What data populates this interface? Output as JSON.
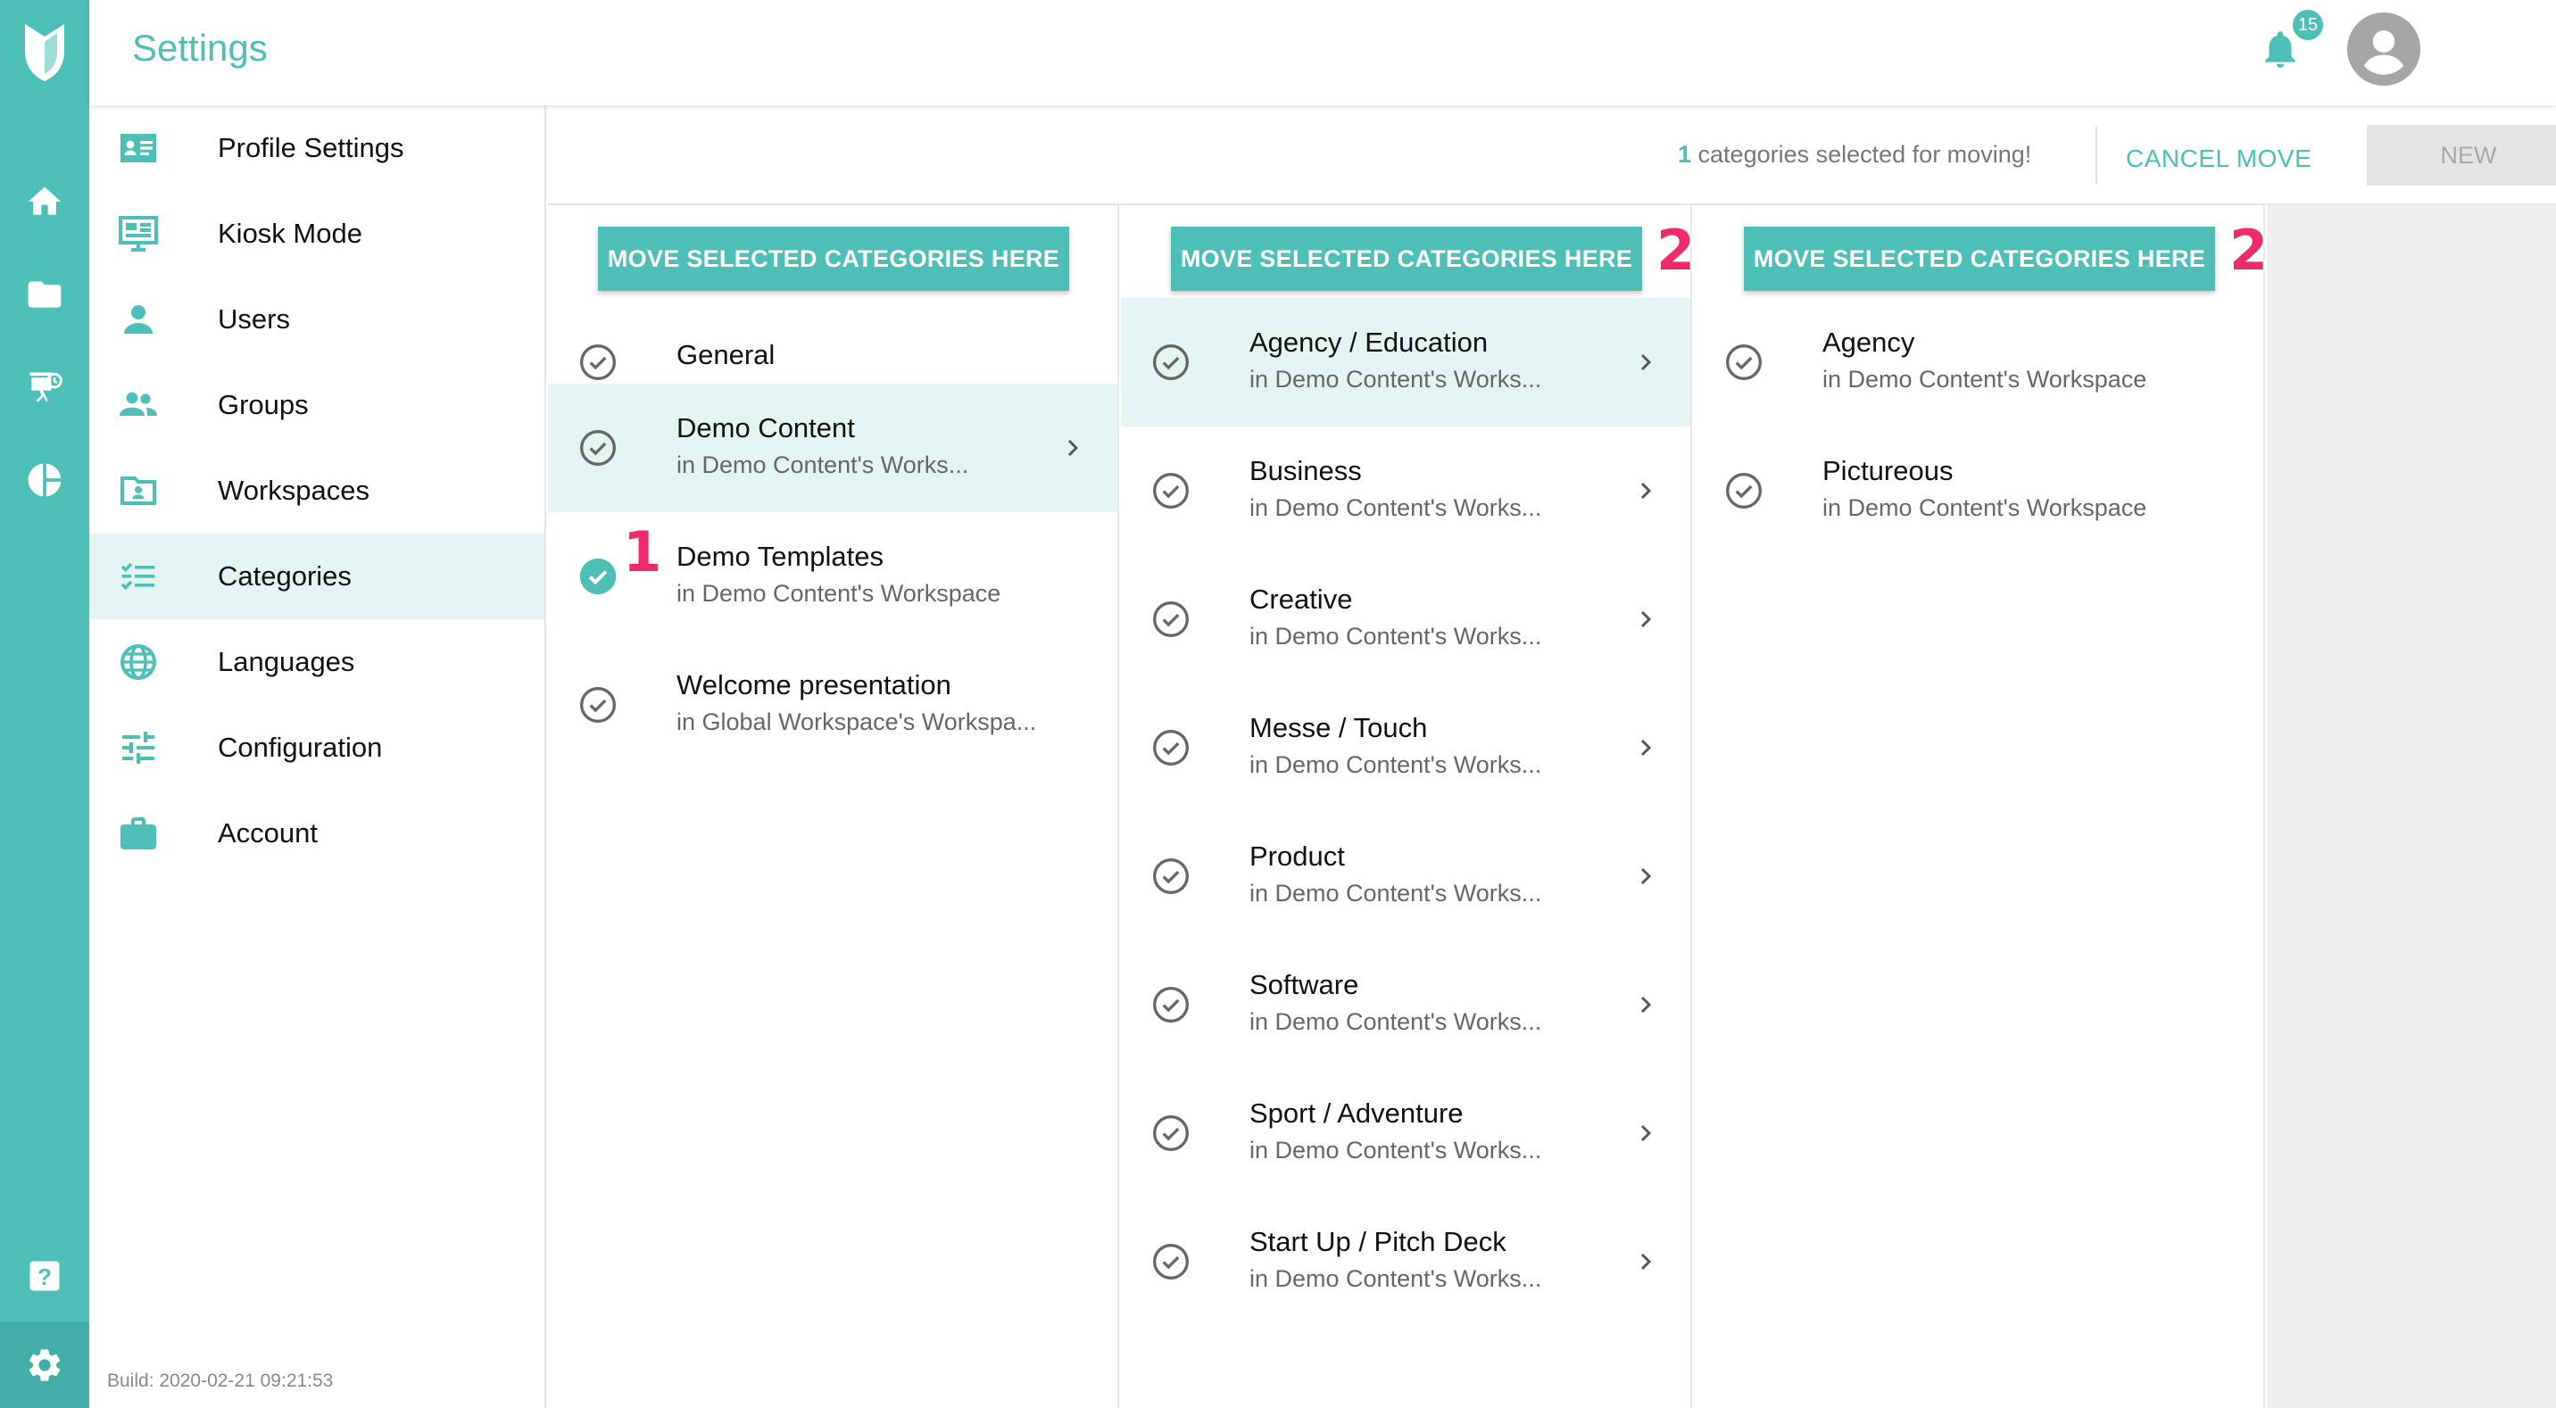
{
  "app": {
    "title": "Settings",
    "notifications": {
      "count": "15"
    },
    "build": "Build: 2020-02-21 09:21:53"
  },
  "rail": {
    "items": [
      {
        "name": "home-icon"
      },
      {
        "name": "folder-icon"
      },
      {
        "name": "presentation-icon"
      },
      {
        "name": "pie-chart-icon"
      },
      {
        "name": "help-icon"
      },
      {
        "name": "gear-icon"
      }
    ]
  },
  "settings_nav": {
    "items": [
      {
        "label": "Profile Settings",
        "icon": "profile-card-icon"
      },
      {
        "label": "Kiosk Mode",
        "icon": "monitor-icon"
      },
      {
        "label": "Users",
        "icon": "user-icon"
      },
      {
        "label": "Groups",
        "icon": "group-icon"
      },
      {
        "label": "Workspaces",
        "icon": "workspace-icon"
      },
      {
        "label": "Categories",
        "icon": "categories-icon",
        "active": true
      },
      {
        "label": "Languages",
        "icon": "globe-icon"
      },
      {
        "label": "Configuration",
        "icon": "sliders-icon"
      },
      {
        "label": "Account",
        "icon": "briefcase-icon"
      }
    ]
  },
  "toolbar": {
    "selected_count": "1",
    "selected_text": " categories selected for moving!",
    "cancel_label": "CANCEL MOVE",
    "new_label": "NEW"
  },
  "columns": [
    {
      "move_label": "MOVE SELECTED CATEGORIES HERE",
      "items": [
        {
          "name": "General",
          "sub": "",
          "selected": false,
          "chevron": false
        },
        {
          "name": "Demo Content",
          "sub": "in Demo Content's Works...",
          "selected": false,
          "chevron": true,
          "active": true
        },
        {
          "name": "Demo Templates",
          "sub": "in Demo Content's Workspace",
          "selected": true,
          "chevron": false,
          "marker": "1"
        },
        {
          "name": "Welcome presentation",
          "sub": "in Global Workspace's Workspa...",
          "selected": false,
          "chevron": false
        }
      ]
    },
    {
      "move_label": "MOVE SELECTED CATEGORIES HERE",
      "marker": "2",
      "items": [
        {
          "name": "Agency / Education",
          "sub": "in Demo Content's Works...",
          "chevron": true,
          "active": true
        },
        {
          "name": "Business",
          "sub": "in Demo Content's Works...",
          "chevron": true
        },
        {
          "name": "Creative",
          "sub": "in Demo Content's Works...",
          "chevron": true
        },
        {
          "name": "Messe / Touch",
          "sub": "in Demo Content's Works...",
          "chevron": true
        },
        {
          "name": "Product",
          "sub": "in Demo Content's Works...",
          "chevron": true
        },
        {
          "name": "Software",
          "sub": "in Demo Content's Works...",
          "chevron": true
        },
        {
          "name": "Sport / Adventure",
          "sub": "in Demo Content's Works...",
          "chevron": true
        },
        {
          "name": "Start Up / Pitch Deck",
          "sub": "in Demo Content's Works...",
          "chevron": true
        }
      ]
    },
    {
      "move_label": "MOVE SELECTED CATEGORIES HERE",
      "marker": "2",
      "items": [
        {
          "name": "Agency",
          "sub": "in Demo Content's Workspace",
          "chevron": false
        },
        {
          "name": "Pictureous",
          "sub": "in Demo Content's Workspace",
          "chevron": false
        }
      ]
    }
  ],
  "colors": {
    "accent": "#4dbfb7",
    "active_row": "#e4f4f3",
    "marker": "#ee2a6a"
  }
}
